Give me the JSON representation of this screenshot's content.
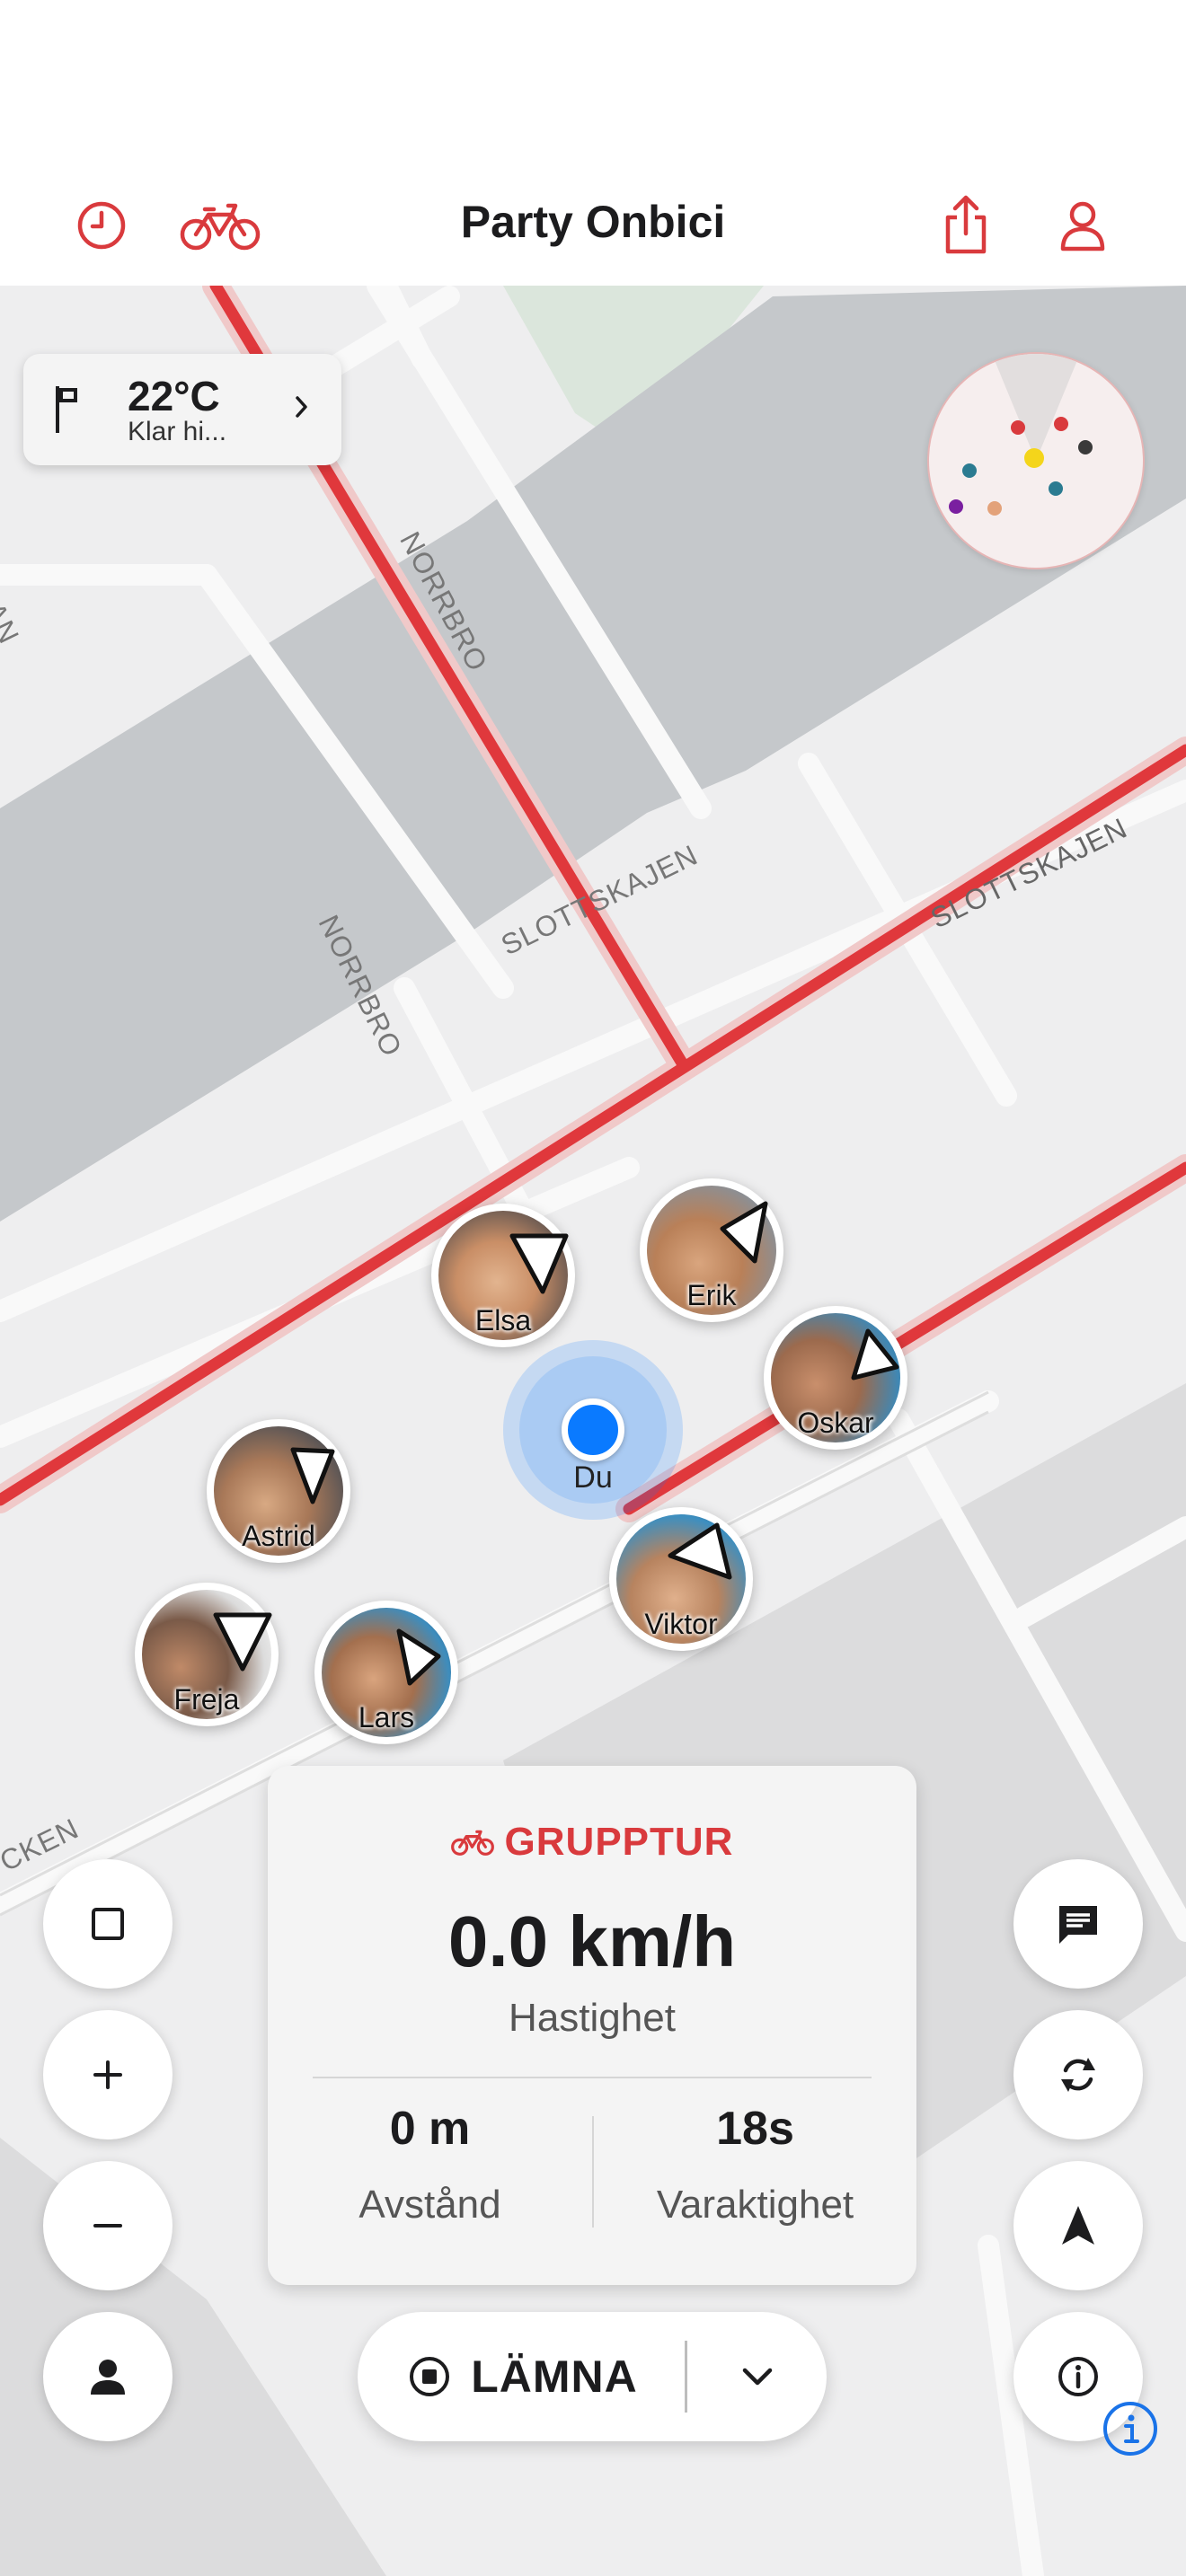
{
  "header": {
    "title": "Party Onbici"
  },
  "weather": {
    "temperature": "22°C",
    "description": "Klar hi..."
  },
  "riders": [
    {
      "name": "Elsa"
    },
    {
      "name": "Erik"
    },
    {
      "name": "Oskar"
    },
    {
      "name": "Astrid"
    },
    {
      "name": "Viktor"
    },
    {
      "name": "Freja"
    },
    {
      "name": "Lars"
    }
  ],
  "self": {
    "name": "Du"
  },
  "map": {
    "street_labels": [
      "NORRBRO",
      "NORRBRO",
      "SLOTTSKAJEN",
      "SLOTTSKAJEN",
      "LAN",
      "CKEN"
    ]
  },
  "stats": {
    "mode": "GRUPPTUR",
    "speed_value": "0.0 km/h",
    "speed_label": "Hastighet",
    "distance_value": "0 m",
    "distance_label": "Avstånd",
    "duration_value": "18s",
    "duration_label": "Varaktighet"
  },
  "leave": {
    "label": "LÄMNA"
  },
  "colors": {
    "accent": "#d93a3d",
    "route": "#e0383c",
    "location": "#0a7aff",
    "water": "#c5c8cb",
    "park": "#dbe6dc"
  },
  "icons": [
    "history-icon",
    "bike-icon",
    "share-icon",
    "profile-icon",
    "flag-icon",
    "chevron-right-icon",
    "square-icon",
    "plus-icon",
    "minus-icon",
    "person-icon",
    "chat-icon",
    "refresh-icon",
    "navigation-arrow-icon",
    "info-icon",
    "stop-icon",
    "chevron-down-icon"
  ]
}
